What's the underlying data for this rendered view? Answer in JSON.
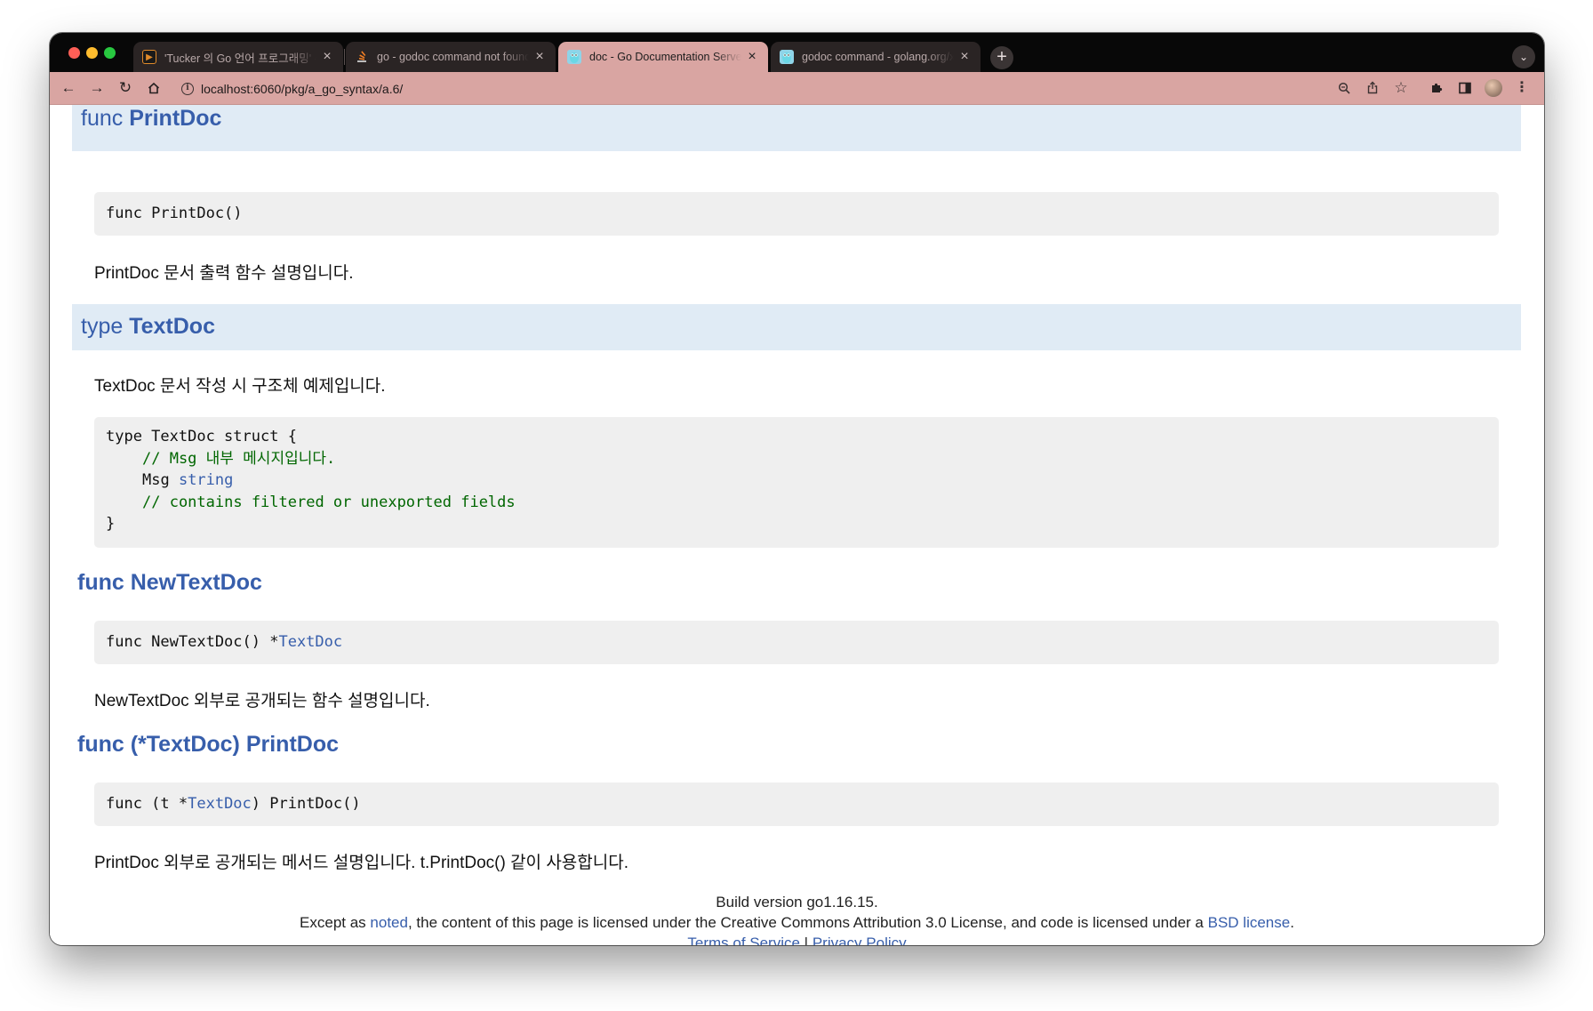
{
  "browser": {
    "tabs": [
      {
        "title": "'Tucker 의 Go 언어 프로그래밍' 수",
        "icon": "tucker-favicon-icon",
        "active": false
      },
      {
        "title": "go - godoc command not found",
        "icon": "stackoverflow-favicon-icon",
        "active": false
      },
      {
        "title": "doc - Go Documentation Server",
        "icon": "gopher-favicon-icon",
        "active": true
      },
      {
        "title": "godoc command - golang.org/x",
        "icon": "gopher-favicon-icon",
        "active": false
      }
    ],
    "url": "localhost:6060/pkg/a_go_syntax/a.6/",
    "accent_color": "#d9a5a2"
  },
  "doc": {
    "printdoc_func": {
      "kw": "func ",
      "name": "PrintDoc",
      "signature": "func PrintDoc()",
      "description": "PrintDoc 문서 출력 함수 설명입니다."
    },
    "textdoc_type": {
      "kw": "type ",
      "name": "TextDoc",
      "description": "TextDoc 문서 작성 시 구조체 예제입니다.",
      "code_line1": "type TextDoc struct {",
      "code_comment1": "// Msg 내부 메시지입니다.",
      "code_field": "Msg ",
      "code_field_type": "string",
      "code_comment2": "// contains filtered or unexported fields",
      "code_close": "}"
    },
    "newtextdoc_func": {
      "kw": "func ",
      "name": "NewTextDoc",
      "sig_prefix": "func NewTextDoc() *",
      "sig_type": "TextDoc",
      "description": "NewTextDoc 외부로 공개되는 함수 설명입니다."
    },
    "method_printdoc": {
      "heading": "func (*TextDoc) PrintDoc",
      "sig_prefix": "func (t *",
      "sig_type": "TextDoc",
      "sig_suffix": ") PrintDoc()",
      "description": "PrintDoc 외부로 공개되는 메서드 설명입니다. t.PrintDoc() 같이 사용합니다."
    }
  },
  "footer": {
    "build": "Build version go1.16.15.",
    "license_prefix": "Except as ",
    "noted_link": "noted",
    "license_middle": ", the content of this page is licensed under the Creative Commons Attribution 3.0 License, and code is licensed under a ",
    "bsd_link": "BSD license",
    "license_end": ".",
    "terms_link": "Terms of Service",
    "separator": " | ",
    "privacy_link": "Privacy Policy"
  }
}
